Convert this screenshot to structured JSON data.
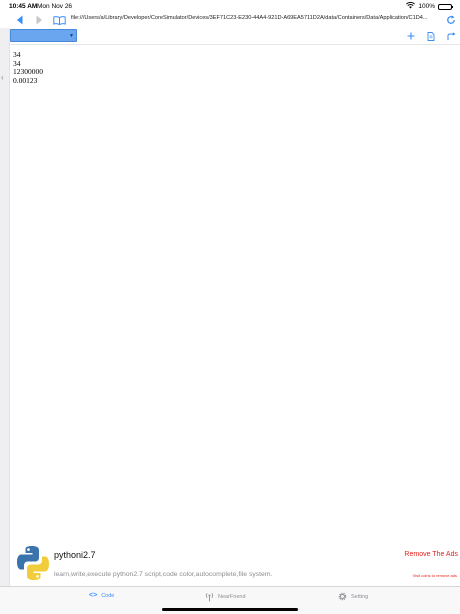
{
  "status_bar": {
    "time": "10:45 AM",
    "date": "Mon Nov 26",
    "battery": "100%",
    "battery_level": 1.0
  },
  "nav": {
    "back_icon": "chevron-left-icon",
    "forward_icon": "chevron-right-icon",
    "bookmarks_icon": "book-icon",
    "url": "file:///Users/a/Library/Developer/CoreSimulator/Devices/3EF71C23-E230-44A4-921D-A69EA5711D2A/data/Containers/Data/Application/C1D4...",
    "reload_icon": "reload-icon"
  },
  "toolbar": {
    "select_value": "",
    "icons": [
      "plus-icon",
      "document-icon",
      "share-icon"
    ]
  },
  "output": {
    "lines": [
      "34",
      "34",
      "12300000",
      "0.00123"
    ]
  },
  "ad": {
    "title": "pythoni2.7",
    "description": "learn,write,execute python2.7 script,code color,autocomplete,file system.",
    "remove_label": "Remove The Ads",
    "remove_sub": "Visit coins to remove ads"
  },
  "tabs": [
    {
      "label": "Code",
      "icon": "code-icon",
      "active": true
    },
    {
      "label": "NearFriend",
      "icon": "antenna-icon",
      "active": false
    },
    {
      "label": "Setting",
      "icon": "gear-icon",
      "active": false
    }
  ],
  "colors": {
    "accent": "#3a8ef6",
    "select_fill": "#6aa6f0",
    "ad_remove": "#e3221c"
  }
}
